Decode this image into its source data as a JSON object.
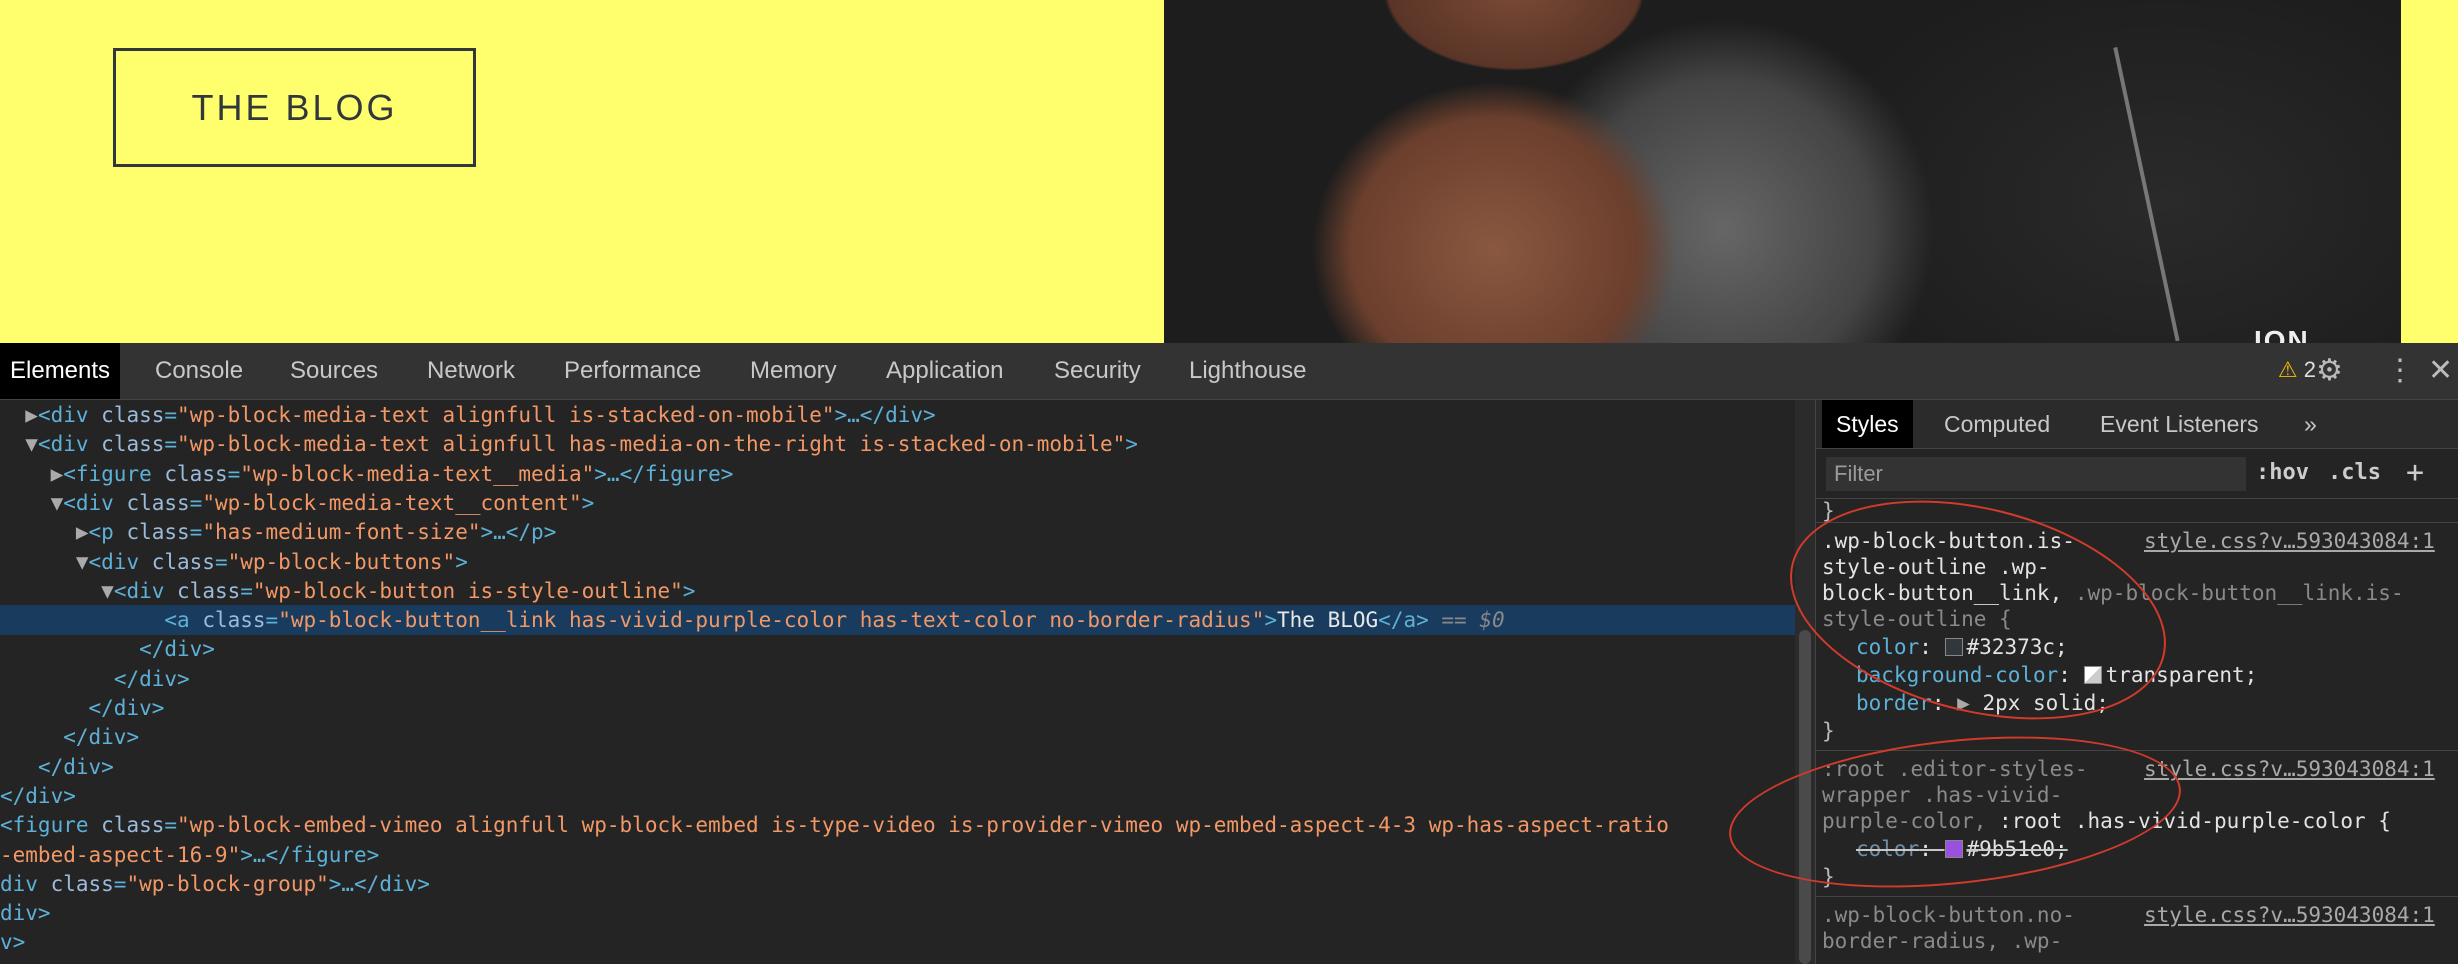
{
  "page": {
    "button_label": "THE BLOG",
    "photo_watermark": "ION"
  },
  "devtools": {
    "tabs": [
      "Elements",
      "Console",
      "Sources",
      "Network",
      "Performance",
      "Memory",
      "Application",
      "Security",
      "Lighthouse"
    ],
    "active_tab": "Elements",
    "warning_count": "2",
    "elements": [
      {
        "indent": "  ",
        "arrow": "▶",
        "tag_open": "<div ",
        "attr": "class",
        "value": "\"wp-block-media-text alignfull is-stacked-on-mobile\"",
        "rest": ">…</div>"
      },
      {
        "indent": "  ",
        "arrow": "▼",
        "tag_open": "<div ",
        "attr": "class",
        "value": "\"wp-block-media-text alignfull has-media-on-the-right is-stacked-on-mobile\"",
        "rest": ">"
      },
      {
        "indent": "    ",
        "arrow": "▶",
        "tag_open": "<figure ",
        "attr": "class",
        "value": "\"wp-block-media-text__media\"",
        "rest": ">…</figure>"
      },
      {
        "indent": "    ",
        "arrow": "▼",
        "tag_open": "<div ",
        "attr": "class",
        "value": "\"wp-block-media-text__content\"",
        "rest": ">"
      },
      {
        "indent": "      ",
        "arrow": "▶",
        "tag_open": "<p ",
        "attr": "class",
        "value": "\"has-medium-font-size\"",
        "rest": ">…</p>"
      },
      {
        "indent": "      ",
        "arrow": "▼",
        "tag_open": "<div ",
        "attr": "class",
        "value": "\"wp-block-buttons\"",
        "rest": ">"
      },
      {
        "indent": "        ",
        "arrow": "▼",
        "tag_open": "<div ",
        "attr": "class",
        "value": "\"wp-block-button is-style-outline\"",
        "rest": ">"
      },
      {
        "indent": "            ",
        "arrow": "",
        "tag_open": "<a ",
        "attr": "class",
        "value": "\"wp-block-button__link has-vivid-purple-color has-text-color no-border-radius\"",
        "text": "The BLOG",
        "rest": "</a>",
        "suffix": " == $0",
        "selected": true
      },
      {
        "indent": "          ",
        "arrow": "",
        "tag_open": "</div>",
        "attr": "",
        "value": "",
        "rest": ""
      },
      {
        "indent": "        ",
        "arrow": "",
        "tag_open": "</div>",
        "attr": "",
        "value": "",
        "rest": ""
      },
      {
        "indent": "      ",
        "arrow": "",
        "tag_open": "</div>",
        "attr": "",
        "value": "",
        "rest": ""
      },
      {
        "indent": "    ",
        "arrow": "",
        "tag_open": "</div>",
        "attr": "",
        "value": "",
        "rest": ""
      },
      {
        "indent": "  ",
        "arrow": "",
        "tag_open": "</div>",
        "attr": "",
        "value": "",
        "rest": ""
      },
      {
        "indent": "",
        "arrow": "",
        "tag_open": "</div>",
        "attr": "",
        "value": "",
        "rest": ""
      },
      {
        "indent": "",
        "arrow": "",
        "tag_open": "<figure ",
        "attr": "class",
        "value": "\"wp-block-embed-vimeo alignfull wp-block-embed is-type-video is-provider-vimeo wp-embed-aspect-4-3 wp-has-aspect-ratio",
        "rest": ""
      },
      {
        "indent": "",
        "arrow": "",
        "tag_open": "",
        "attr": "",
        "value": "-embed-aspect-16-9\"",
        "rest": ">…</figure>"
      },
      {
        "indent": "",
        "arrow": "",
        "tag_open": "div ",
        "attr": "class",
        "value": "\"wp-block-group\"",
        "rest": ">…</div>"
      },
      {
        "indent": "",
        "arrow": "",
        "tag_open": "div>",
        "attr": "",
        "value": "",
        "rest": ""
      },
      {
        "indent": "",
        "arrow": "",
        "tag_open": "v>",
        "attr": "",
        "value": "",
        "rest": ""
      }
    ],
    "styles_tabs": [
      "Styles",
      "Computed",
      "Event Listeners"
    ],
    "filter_placeholder": "Filter",
    "hov": ":hov",
    "cls": ".cls",
    "rules": {
      "r1_sel1": ".wp-block-button.is-",
      "r1_sel2": "style-outline .wp-",
      "r1_sel3": "block-button__link, ",
      "r1_sel3b": ".wp-block-button__link.is-",
      "r1_sel4": "style-outline {",
      "r1_src": "style.css?v…593043084:1",
      "r1_p1n": "color",
      "r1_p1v": "#32373c;",
      "r1_p1c": "#32373c",
      "r1_p2n": "background-color",
      "r1_p2v": "transparent;",
      "r1_p3n": "border",
      "r1_p3v": "2px solid;",
      "r2_sel1": ":root .editor-styles-",
      "r2_sel2": "wrapper .has-vivid-",
      "r2_sel3": "purple-color, ",
      "r2_sel3b": ":root .has-vivid-purple-color {",
      "r2_src": "style.css?v…593043084:1",
      "r2_p1n": "color",
      "r2_p1v": "#9b51e0;",
      "r2_p1c": "#9b51e0",
      "r3_sel1": ".wp-block-button.no-",
      "r3_sel2": "border-radius, .wp-",
      "r3_src": "style.css?v…593043084:1"
    }
  }
}
